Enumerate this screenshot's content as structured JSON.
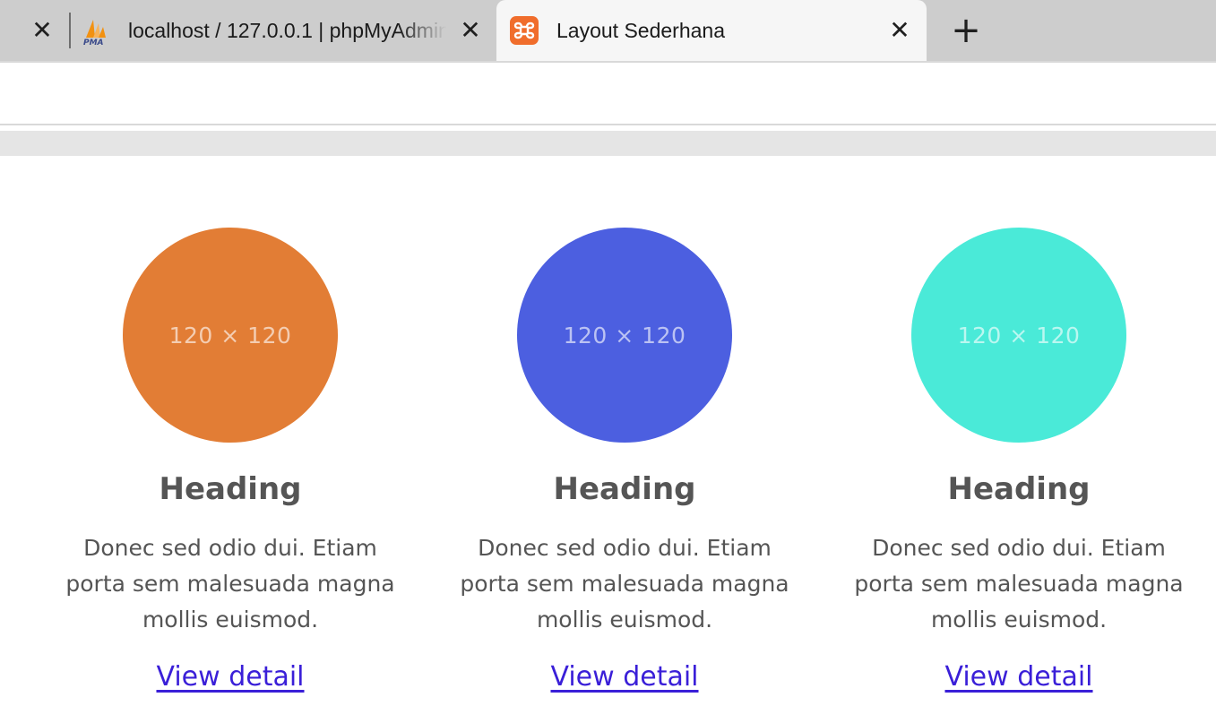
{
  "browser": {
    "tabs": [
      {
        "title": "localhost / 127.0.0.1 | phpMyAdmin",
        "icon": "phpmyadmin-icon",
        "active": false
      },
      {
        "title": "Layout Sederhana",
        "icon": "xampp-icon",
        "active": true
      }
    ],
    "close_glyph": "✕",
    "new_tab_glyph": "+"
  },
  "cards": [
    {
      "thumb_label": "120 × 120",
      "thumb_color": "#e27d35",
      "heading": "Heading",
      "text": "Donec sed odio dui. Etiam porta sem malesuada magna mollis euismod.",
      "link": "View detail"
    },
    {
      "thumb_label": "120 × 120",
      "thumb_color": "#4c5fe0",
      "heading": "Heading",
      "text": "Donec sed odio dui. Etiam porta sem malesuada magna mollis euismod.",
      "link": "View detail"
    },
    {
      "thumb_label": "120 × 120",
      "thumb_color": "#4aead8",
      "heading": "Heading",
      "text": "Donec sed odio dui. Etiam porta sem malesuada magna mollis euismod.",
      "link": "View detail"
    }
  ]
}
